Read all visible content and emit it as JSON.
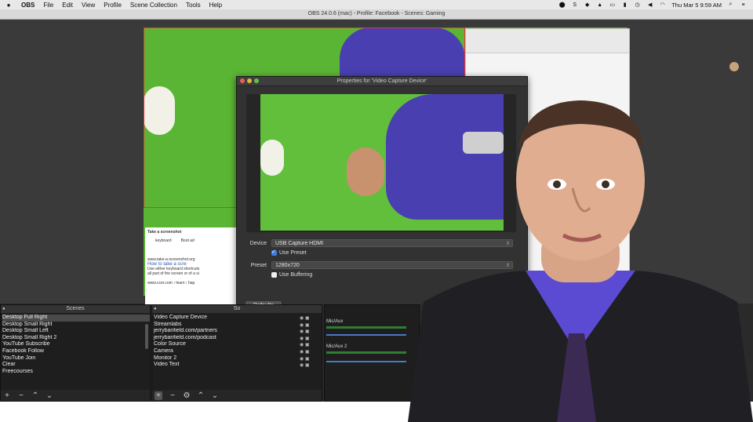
{
  "menubar": {
    "app_name": "OBS",
    "items": [
      "File",
      "Edit",
      "View",
      "Profile",
      "Scene Collection",
      "Tools",
      "Help"
    ],
    "status_icons": [
      "record-icon",
      "skype-icon",
      "dropbox-icon",
      "drive-icon",
      "display-icon",
      "battery-icon",
      "time-machine-icon",
      "volume-icon",
      "wifi-icon"
    ],
    "datetime": "Thu Mar 5  9:59 AM"
  },
  "window": {
    "title": "OBS 24.0.6 (mac) - Profile: Facebook - Scenes: Gaming"
  },
  "snippet": {
    "heading": "Take a screenshot",
    "col1": "keyboard",
    "col2": "Boot ad",
    "url": "www.take-a-screenshot.org",
    "link": "How to take a scre",
    "body": "Use either keyboard shortcuts",
    "body2": "all part of the screen or of a si",
    "url2": "www.ccer.com › learn › hap"
  },
  "dialog": {
    "title": "Properties for 'Video Capture Device'",
    "device_label": "Device",
    "device_value": "USB Capture HDMI",
    "use_preset_label": "Use Preset",
    "use_preset_checked": true,
    "preset_label": "Preset",
    "preset_value": "1280x720",
    "use_buffering_label": "Use Buffering",
    "use_buffering_checked": false,
    "defaults_button": "Defaults"
  },
  "scenes": {
    "header": "Scenes",
    "items": [
      "Desktop Full Right",
      "Desktop Small Right",
      "Desktop Small Left",
      "Desktop Small Right 2",
      "YouTube Subscribe",
      "Facebook Follow",
      "YouTube Join",
      "Clear",
      "Freecourses"
    ],
    "selected_index": 0
  },
  "sources": {
    "header": "So",
    "items": [
      "Video Capture Device",
      "Streamlabs",
      "jerrybanfield.com/partners",
      "jerrybanfield.com/podcast",
      "Color Source",
      "Camera",
      "Monitor 2",
      "Video Text"
    ]
  },
  "mixer": {
    "channels": [
      "Mic/Aux",
      "Mic/Aux 2"
    ]
  },
  "colors": {
    "green_screen": "#5bb534",
    "obs_dark": "#2b2b2b",
    "accent_blue": "#3d7de4"
  }
}
